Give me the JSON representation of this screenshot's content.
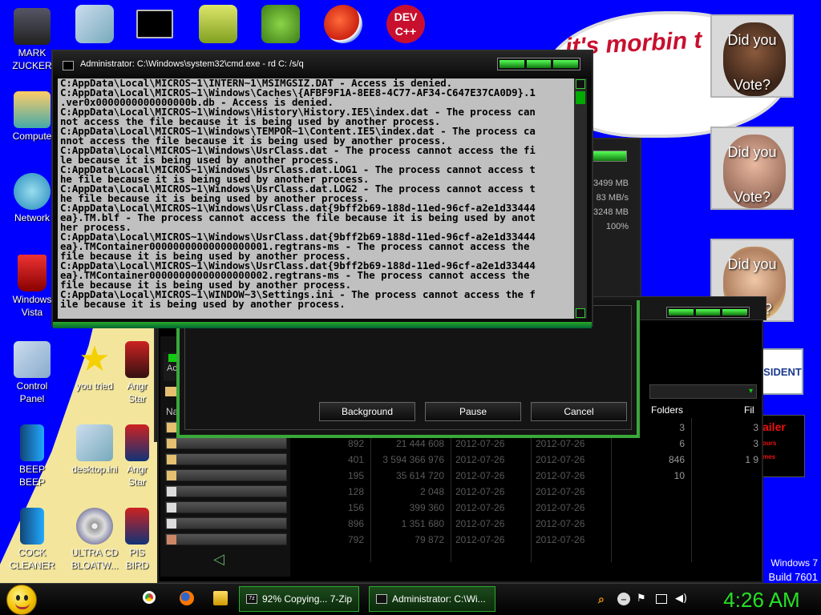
{
  "desktop": {
    "icons": [
      {
        "label": "MARK\nZUCKER"
      },
      {
        "label": "Compute"
      },
      {
        "label": "Network"
      },
      {
        "label": "Windows\nVista"
      },
      {
        "label": "Control\nPanel"
      },
      {
        "label": "you tried"
      },
      {
        "label": "Angr\nStar"
      },
      {
        "label": "BEEP\nBEEP"
      },
      {
        "label": "desktop.ini"
      },
      {
        "label": "Angr\nStar"
      },
      {
        "label": "COCK\nCLEANER"
      },
      {
        "label": "ULTRA CD\nBLOATW..."
      },
      {
        "label": "PIS\nBIRD"
      }
    ],
    "top_icons": [
      {
        "icon": "folder-icon"
      },
      {
        "icon": "cmd-icon"
      },
      {
        "icon": "network-drive-icon"
      },
      {
        "icon": "bad-piggies-icon"
      },
      {
        "icon": "palette-p-icon"
      },
      {
        "icon": "dev-cpp-icon",
        "label": "DEV\nC++"
      }
    ],
    "wallpaper": {
      "morbin_text": "it's morbin t",
      "vote_cards": [
        {
          "top": "Did you",
          "bottom": "Vote?"
        },
        {
          "top": "Did you",
          "bottom": "Vote?"
        },
        {
          "top": "Did you",
          "bottom": "?"
        }
      ],
      "badge": "SIDENT",
      "trailer": {
        "title": "ailer",
        "line1": "ours",
        "line2": "mes"
      },
      "os_name": "Windows 7",
      "build": "Build 7601"
    }
  },
  "cmd": {
    "title": "Administrator: C:\\Windows\\system32\\cmd.exe - rd  C: /s/q",
    "lines": [
      "C:AppData\\Local\\MICROS~1\\INTERN~1\\MSIMGSIZ.DAT - Access is denied.",
      "C:AppData\\Local\\MICROS~1\\Windows\\Caches\\{AFBF9F1A-8EE8-4C77-AF34-C647E37CA0D9}.1",
      ".ver0x0000000000000000b.db - Access is denied.",
      "C:AppData\\Local\\MICROS~1\\Windows\\History\\History.IE5\\index.dat - The process can",
      "not access the file because it is being used by another process.",
      "C:AppData\\Local\\MICROS~1\\Windows\\TEMPOR~1\\Content.IE5\\index.dat - The process ca",
      "nnot access the file because it is being used by another process.",
      "C:AppData\\Local\\MICROS~1\\Windows\\UsrClass.dat - The process cannot access the fi",
      "le because it is being used by another process.",
      "C:AppData\\Local\\MICROS~1\\Windows\\UsrClass.dat.LOG1 - The process cannot access t",
      "he file because it is being used by another process.",
      "C:AppData\\Local\\MICROS~1\\Windows\\UsrClass.dat.LOG2 - The process cannot access t",
      "he file because it is being used by another process.",
      "C:AppData\\Local\\MICROS~1\\Windows\\UsrClass.dat{9bff2b69-188d-11ed-96cf-a2e1d33444",
      "ea}.TM.blf - The process cannot access the file because it is being used by anot",
      "her process.",
      "C:AppData\\Local\\MICROS~1\\Windows\\UsrClass.dat{9bff2b69-188d-11ed-96cf-a2e1d33444",
      "ea}.TMContainer00000000000000000001.regtrans-ms - The process cannot access the",
      "file because it is being used by another process.",
      "C:AppData\\Local\\MICROS~1\\Windows\\UsrClass.dat{9bff2b69-188d-11ed-96cf-a2e1d33444",
      "ea}.TMContainer00000000000000000002.regtrans-ms - The process cannot access the",
      "file because it is being used by another process.",
      "C:AppData\\Local\\MICROS~1\\WINDOW~3\\Settings.ini - The process cannot access the f",
      "ile because it is being used by another process."
    ]
  },
  "zip_progress": {
    "info": [
      "3499 MB",
      "83 MB/s",
      "3248 MB",
      "3248 MB",
      "100%"
    ],
    "buttons": {
      "background": "Background",
      "pause": "Pause",
      "cancel": "Cancel"
    }
  },
  "file_manager": {
    "left_labels": {
      "add": "Ac",
      "name": "Na"
    },
    "headers": {
      "folders": "Folders",
      "files": "Fil"
    },
    "rows": [
      {
        "size": "",
        "packed": "",
        "modified": "",
        "created": "",
        "folders": "3",
        "files": "3"
      },
      {
        "size": "892",
        "packed": "21 444 608",
        "modified": "2012-07-26",
        "created": "2012-07-26",
        "folders": "6",
        "files": "3"
      },
      {
        "size": "401",
        "packed": "3 594 366 976",
        "modified": "2012-07-26",
        "created": "2012-07-26",
        "folders": "846",
        "files": "1 9"
      },
      {
        "size": "195",
        "packed": "35 614 720",
        "modified": "2012-07-26",
        "created": "2012-07-26",
        "folders": "10",
        "files": ""
      },
      {
        "size": "128",
        "packed": "2 048",
        "modified": "2012-07-26",
        "created": "2012-07-26",
        "folders": "",
        "files": ""
      },
      {
        "size": "156",
        "packed": "399 360",
        "modified": "2012-07-26",
        "created": "2012-07-26",
        "folders": "",
        "files": ""
      },
      {
        "size": "896",
        "packed": "1 351 680",
        "modified": "2012-07-26",
        "created": "2012-07-26",
        "folders": "",
        "files": ""
      },
      {
        "size": "792",
        "packed": "79 872",
        "modified": "2012-07-26",
        "created": "2012-07-26",
        "folders": "",
        "files": ""
      }
    ]
  },
  "taskbar": {
    "pinned": [
      {
        "icon": "chrome-icon"
      },
      {
        "icon": "firefox-icon"
      },
      {
        "icon": "explorer-folder-icon"
      }
    ],
    "tasks": [
      {
        "icon": "7z",
        "label": "92% Copying... 7-Zip",
        "progress_percent": 92
      },
      {
        "icon": "",
        "label": "Administrator: C:\\Wi..."
      }
    ],
    "tray": [
      {
        "icon": "search-icon"
      },
      {
        "icon": "minus-icon"
      },
      {
        "icon": "flag-icon"
      },
      {
        "icon": "network-icon"
      },
      {
        "icon": "volume-icon"
      }
    ],
    "clock": "4:26 AM"
  }
}
